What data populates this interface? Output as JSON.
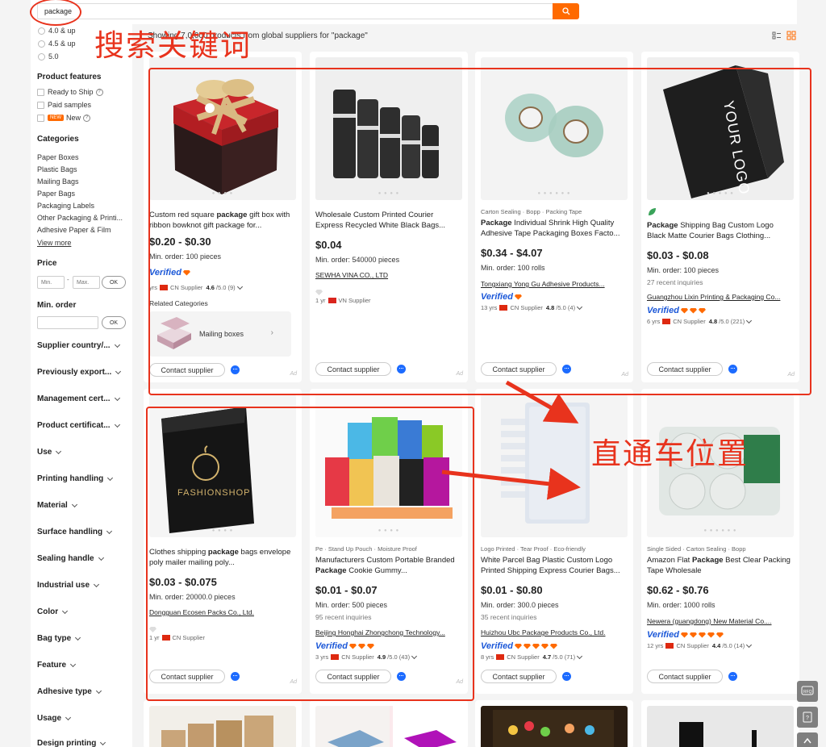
{
  "search": {
    "value": "package"
  },
  "sidebar": {
    "ratings": [
      "4.0 & up",
      "4.5 & up",
      "5.0"
    ],
    "features_title": "Product features",
    "features": [
      "Ready to Ship",
      "Paid samples",
      "New"
    ],
    "new_tag": "NEW",
    "categories_title": "Categories",
    "categories": [
      "Paper Boxes",
      "Plastic Bags",
      "Mailing Bags",
      "Paper Bags",
      "Packaging Labels",
      "Other Packaging & Printi...",
      "Adhesive Paper & Film"
    ],
    "view_more": "View more",
    "price_title": "Price",
    "price_min_placeholder": "Min.",
    "price_max_placeholder": "Max.",
    "ok_label": "OK",
    "min_order_title": "Min. order",
    "dropdowns": [
      "Supplier country/...",
      "Previously export...",
      "Management cert...",
      "Product certificat...",
      "Use",
      "Printing handling",
      "Material",
      "Surface handling",
      "Sealing handle",
      "Industrial use",
      "Color",
      "Bag type",
      "Feature",
      "Adhesive type",
      "Usage",
      "Design printing"
    ]
  },
  "results": {
    "count_text": "Showing 7,0,000 products from global suppliers for \"package\""
  },
  "cards": [
    {
      "tags": "",
      "title_pre": "Custom red square ",
      "title_bold": "package",
      "title_post": " gift box with ribbon bowknot gift package for...",
      "price": "$0.20 - $0.30",
      "min_order": "Min. order: 100 pieces",
      "inquiries": "",
      "supplier": "",
      "verified": "Verified",
      "years": "yrs",
      "country": "CN Supplier",
      "rating": "4.6",
      "rating_suffix": "/5.0 (9)",
      "related_label": "Related Categories",
      "related_name": "Mailing boxes",
      "contact": "Contact supplier",
      "ad": "Ad"
    },
    {
      "tags": "",
      "title_pre": "Wholesale Custom Printed Courier Express Recycled White Black Bags...",
      "title_bold": "",
      "title_post": "",
      "price": "$0.04",
      "min_order": "Min. order: 540000 pieces",
      "inquiries": "",
      "supplier": "SEWHA VINA CO., LTD",
      "verified": "",
      "years": "1 yr",
      "country": "VN Supplier",
      "rating": "",
      "rating_suffix": "",
      "contact": "Contact supplier",
      "ad": "Ad"
    },
    {
      "tags": "Carton Sealing · Bopp · Packing Tape",
      "title_pre": "",
      "title_bold": "Package",
      "title_post": " Individual Shrink High Quality Adhesive Tape Packaging Boxes Facto...",
      "price": "$0.34 - $4.07",
      "min_order": "Min. order: 100 rolls",
      "inquiries": "",
      "supplier": "Tongxiang Yong Gu Adhesive Products...",
      "verified": "Verified",
      "years": "13 yrs",
      "country": "CN Supplier",
      "rating": "4.8",
      "rating_suffix": "/5.0 (4)",
      "contact": "Contact supplier",
      "ad": "Ad"
    },
    {
      "tags": "",
      "title_pre": "",
      "title_bold": "Package",
      "title_post": " Shipping Bag Custom Logo Black Matte Courier Bags Clothing...",
      "price": "$0.03 - $0.08",
      "min_order": "Min. order: 100 pieces",
      "inquiries": "27 recent inquiries",
      "supplier": "Guangzhou Lixin Printing & Packaging Co...",
      "verified": "Verified",
      "years": "6 yrs",
      "country": "CN Supplier",
      "rating": "4.8",
      "rating_suffix": "/5.0 (221)",
      "image_text": "YOUR LOGO",
      "contact": "Contact supplier",
      "ad": "Ad"
    },
    {
      "tags": "",
      "title_pre": "Clothes shipping ",
      "title_bold": "package",
      "title_post": " bags envelope poly mailer mailing poly...",
      "price": "$0.03 - $0.075",
      "min_order": "Min. order: 20000.0 pieces",
      "inquiries": "",
      "supplier": "Dongguan Ecosen Packs Co., Ltd.",
      "verified": "",
      "years": "1 yr",
      "country": "CN Supplier",
      "rating": "",
      "rating_suffix": "",
      "image_text": "FASHIONSHOP",
      "contact": "Contact supplier",
      "ad": "Ad"
    },
    {
      "tags": "Pe · Stand Up Pouch · Moisture Proof",
      "title_pre": "Manufacturers Custom Portable Branded ",
      "title_bold": "Package",
      "title_post": " Cookie Gummy...",
      "price": "$0.01 - $0.07",
      "min_order": "Min. order: 500 pieces",
      "inquiries": "95 recent inquiries",
      "supplier": "Beijing Honghai Zhongchong Technology...",
      "verified": "Verified",
      "years": "3 yrs",
      "country": "CN Supplier",
      "rating": "4.9",
      "rating_suffix": "/5.0 (43)",
      "contact": "Contact supplier",
      "ad": "Ad"
    },
    {
      "tags": "Logo Printed · Tear Proof · Eco-friendly",
      "title_pre": "White Parcel Bag Plastic Custom Logo Printed Shipping Express Courier Bags...",
      "title_bold": "",
      "title_post": "",
      "price": "$0.01 - $0.80",
      "min_order": "Min. order: 300.0 pieces",
      "inquiries": "35 recent inquiries",
      "supplier": "Huizhou Ubc Package Products Co., Ltd.",
      "verified": "Verified",
      "years": "8 yrs",
      "country": "CN Supplier",
      "rating": "4.7",
      "rating_suffix": "/5.0 (71)",
      "contact": "Contact supplier",
      "ad": ""
    },
    {
      "tags": "Single Sided · Carton Sealing · Bopp",
      "title_pre": "Amazon Flat ",
      "title_bold": "Package",
      "title_post": " Best Clear Packing Tape Wholesale",
      "price": "$0.62 - $0.76",
      "min_order": "Min. order: 1000 rolls",
      "inquiries": "",
      "supplier": "Newera (guangdong) New Material Co....",
      "verified": "Verified",
      "years": "12 yrs",
      "country": "CN Supplier",
      "rating": "4.4",
      "rating_suffix": "/5.0 (14)",
      "contact": "Contact supplier",
      "ad": ""
    }
  ],
  "annotations": {
    "keyword_label": "搜索关键词",
    "position_label": "直通车位置",
    "color": "#e8331d"
  },
  "colors": {
    "accent": "#ff6a00",
    "verified": "#1c58d8"
  }
}
